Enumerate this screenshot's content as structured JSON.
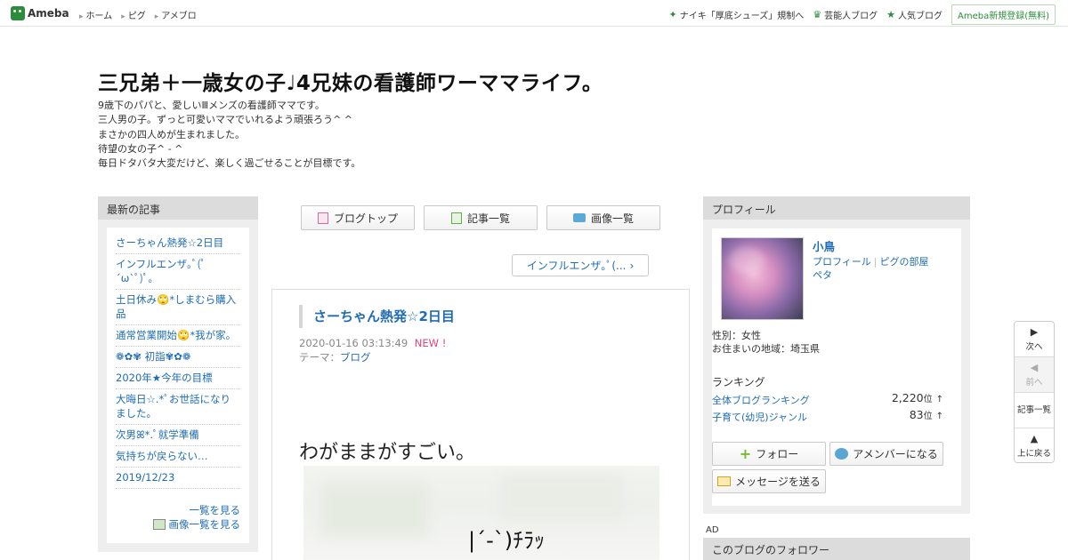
{
  "topbar": {
    "logo": "Ameba",
    "nav": [
      "ホーム",
      "ピグ",
      "アメブロ"
    ],
    "right_links": [
      {
        "label": "ナイキ「厚底シューズ」規制へ",
        "icon": "sparkle-icon"
      },
      {
        "label": "芸能人ブログ",
        "icon": "crown-icon"
      },
      {
        "label": "人気ブログ",
        "icon": "star-icon"
      }
    ],
    "register_label": "Ameba新規登録(無料)"
  },
  "blog": {
    "title": "三兄弟＋一歳女の子♩4兄妹の看護師ワーママライフ。",
    "description": [
      "9歳下のパパと、愛しいⅢメンズの看護師ママです。",
      "三人男の子。ずっと可愛いママでいれるよう頑張ろう^ ^",
      "まさかの四人めが生まれました。",
      "待望の女の子^ - ^",
      "毎日ドタバタ大変だけど、楽しく過ごせることが目標です。"
    ]
  },
  "left_sidebar": {
    "header": "最新の記事",
    "articles": [
      "さーちゃん熱発☆2日目",
      "インフルエンザ｡ﾟ(ﾟ´ω`ﾟ)ﾟ｡",
      "土日休み🙄*しまむら購入品",
      "通常営業開始🙄*我が家。",
      "❁✿✾ 初詣✾✿❁",
      "2020年★今年の目標",
      "大晦日☆.*ﾟお世話になりました。",
      "次男ꕤ*.ﾟ就学準備",
      "気持ちが戻らない…",
      "2019/12/23"
    ],
    "see_all_label": "一覧を見る",
    "image_list_label": "画像一覧を見る"
  },
  "center": {
    "buttons": {
      "blog_top": "ブログトップ",
      "article_list": "記事一覧",
      "image_list": "画像一覧"
    },
    "next_post_label": "インフルエンザ｡ﾟ(...",
    "article": {
      "title": "さーちゃん熱発☆2日目",
      "date": "2020-01-16 03:13:49",
      "new_badge": "NEW !",
      "theme_label": "テーマ：",
      "theme": "ブログ",
      "body_line": "わがままがすごい。",
      "image_caption": "|´-`)ﾁﾗｯ"
    }
  },
  "right_sidebar": {
    "header": "プロフィール",
    "name": "小鳥",
    "links": [
      "プロフィール",
      "ピグの部屋",
      "ペタ"
    ],
    "gender": "性別：女性",
    "region": "お住まいの地域：埼玉県",
    "ranking_header": "ランキング",
    "rankings": [
      {
        "label": "全体ブログランキング",
        "value": "2,220",
        "unit": "位",
        "trend": "↑"
      },
      {
        "label": "子育て(幼児)ジャンル",
        "value": "83",
        "unit": "位",
        "trend": "↑"
      }
    ],
    "follow_label": "フォロー",
    "amember_label": "アメンバーになる",
    "message_label": "メッセージを送る",
    "ad_label": "AD",
    "followers_header": "このブログのフォロワー"
  },
  "float_nav": {
    "next": "次へ",
    "prev": "前へ",
    "list": "記事一覧",
    "top": "上に戻る"
  },
  "colors": {
    "brand_green": "#2d8c3c",
    "link_blue": "#1f6cb4",
    "new_pink": "#e0447c"
  }
}
